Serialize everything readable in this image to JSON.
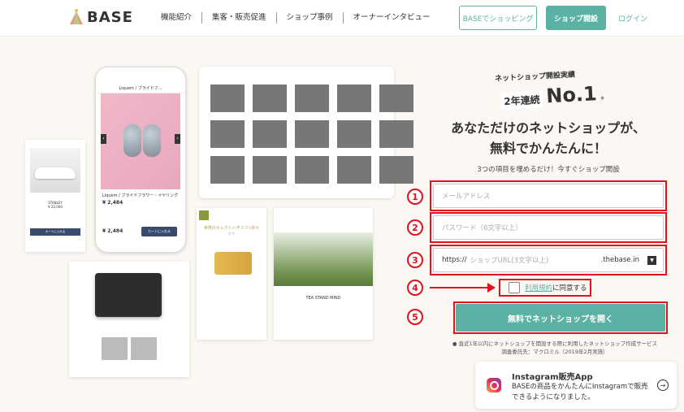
{
  "header": {
    "logo_text": "BASE",
    "nav": [
      "機能紹介",
      "集客・販売促進",
      "ショップ事例",
      "オーナーインタビュー"
    ],
    "btn_shopping": "BASEでショッピング",
    "btn_open": "ショップ開設",
    "login": "ログイン"
  },
  "mockups": {
    "phone_title": "Liquem / ブライドフラワー・イヤリング",
    "phone_price": "¥ 2,484",
    "phone_price2": "¥ 2,484",
    "phone_cart": "カートに入れる",
    "phone_header": "Liquem / ブライドフ...",
    "shoe_name": "STANLEY",
    "shoe_price": "¥ 22,000",
    "shoe_btn": "カートに入れる",
    "select_title": "世界のセレクトハチミツ3本セット",
    "tea_label": "TEA STAND MIND"
  },
  "hero": {
    "jisseki": "ネットショップ開設実績",
    "years": "2年連続",
    "no1": "No.1",
    "no1_note": "※",
    "headline_1": "あなただけのネットショップが、",
    "headline_2": "無料でかんたんに！",
    "sub": "3つの項目を埋めるだけ！今すぐショップ開設"
  },
  "form": {
    "steps": [
      "1",
      "2",
      "3",
      "4",
      "5"
    ],
    "email_placeholder": "メールアドレス",
    "password_placeholder": "パスワード（6文字以上）",
    "url_prefix": "https://",
    "url_placeholder": "ショップURL(3文字以上)",
    "url_suffix": ".thebase.in",
    "agree_link": "利用規約",
    "agree_text": "に同意する",
    "submit": "無料でネットショップを開く",
    "foot_note_1": "● 直近1年以内にネットショップを開設する際に利用したネットショップ作成サービス",
    "foot_note_2": "調査委託先：マクロミル（2019年2月実施）"
  },
  "instagram": {
    "title": "Instagram販売App",
    "desc": "BASEの商品をかんたんにInstagramで販売できるようになりました。"
  },
  "colors": {
    "accent": "#5bb2a4",
    "highlight": "#e0121e"
  }
}
